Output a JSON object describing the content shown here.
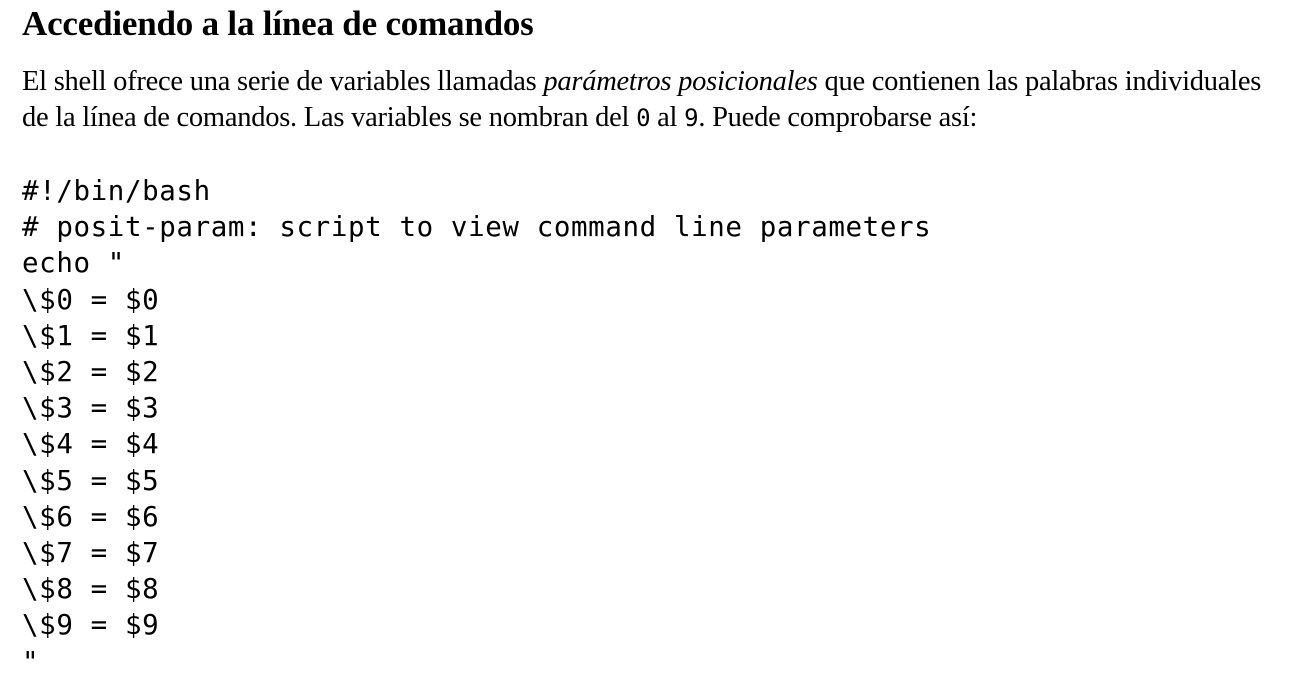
{
  "heading": "Accediendo a la línea de comandos",
  "intro": {
    "part1": "El shell ofrece una serie de variables llamadas ",
    "emphasis": "parámetros posicionales",
    "part2": " que contienen las palabras individuales de la línea de comandos. Las variables se nombran del ",
    "code_first": "0",
    "part3": " al ",
    "code_last": "9",
    "part4": ". Puede comprobarse así:"
  },
  "code_lines": [
    "#!/bin/bash",
    "# posit-param: script to view command line parameters",
    "echo \"",
    "\\$0 = $0",
    "\\$1 = $1",
    "\\$2 = $2",
    "\\$3 = $3",
    "\\$4 = $4",
    "\\$5 = $5",
    "\\$6 = $6",
    "\\$7 = $7",
    "\\$8 = $8",
    "\\$9 = $9",
    "\""
  ]
}
